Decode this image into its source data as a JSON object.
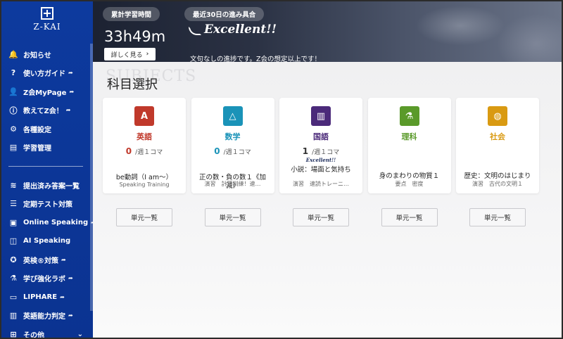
{
  "brand": {
    "logo_text": "Z-KAI"
  },
  "sidebar": {
    "items": [
      {
        "label": "お知らせ",
        "icon": "bell-icon",
        "glyph": "🔔",
        "ext": false
      },
      {
        "label": "使い方ガイド",
        "icon": "help-circle-icon",
        "glyph": "?",
        "ext": true
      },
      {
        "label": "Z会MyPage",
        "icon": "user-icon",
        "glyph": "👤",
        "ext": true
      },
      {
        "label": "教えてZ会！",
        "icon": "info-circle-icon",
        "glyph": "ⓘ",
        "ext": true
      },
      {
        "label": "各種設定",
        "icon": "gear-icon",
        "glyph": "⚙",
        "ext": false
      },
      {
        "label": "学習管理",
        "icon": "id-card-icon",
        "glyph": "▤",
        "ext": false
      }
    ],
    "items2": [
      {
        "label": "提出済み答案一覧",
        "icon": "layers-icon",
        "glyph": "≋",
        "ext": false
      },
      {
        "label": "定期テスト対策",
        "icon": "clipboard-icon",
        "glyph": "☰",
        "ext": false
      },
      {
        "label": "Online Speaking",
        "icon": "online-speaking-icon",
        "glyph": "▣",
        "ext": true
      },
      {
        "label": "AI Speaking",
        "icon": "ai-speaking-icon",
        "glyph": "◫",
        "ext": false
      },
      {
        "label": "英検®対策",
        "icon": "eiken-icon",
        "glyph": "✪",
        "ext": true
      },
      {
        "label": "学び強化ラボ",
        "icon": "flask-icon",
        "glyph": "⚗",
        "ext": true
      },
      {
        "label": "LIPHARE",
        "icon": "monitor-icon",
        "glyph": "▭",
        "ext": true
      },
      {
        "label": "英語能力判定",
        "icon": "chart-monitor-icon",
        "glyph": "▥",
        "ext": true
      },
      {
        "label": "その他",
        "icon": "grid-icon",
        "glyph": "⊞",
        "ext": false
      }
    ],
    "ext_glyph": "➦",
    "chevron": "⌄"
  },
  "header": {
    "study_time_label": "累計学習時間",
    "study_time_value": "33h49m",
    "detail_button": "詳しく見る",
    "progress_label": "最近30日の進み具合",
    "progress_badge": "Excellent!!",
    "progress_message": "文句なしの進捗です。Z会の想定以上です！"
  },
  "main": {
    "watermark": "SUBJECTS",
    "title": "科目選択",
    "unit_button": "単元一覧",
    "weekly_suffix": "/週１コマ",
    "subjects": [
      {
        "name": "英語",
        "color": "#c0392b",
        "icon": "english-icon",
        "glyph": "A",
        "count": "0",
        "count_color": "#c0392b",
        "excellent": "",
        "lesson": "be動詞（I am～）",
        "meta": "Speaking Training"
      },
      {
        "name": "数学",
        "color": "#1a93b8",
        "icon": "compass-icon",
        "glyph": "△",
        "count": "0",
        "count_color": "#1a93b8",
        "excellent": "",
        "lesson": "正の数・負の数１《加減》",
        "meta": "演習　計算訓練！速…"
      },
      {
        "name": "国語",
        "color": "#4b2a7a",
        "icon": "books-icon",
        "glyph": "▥",
        "count": "1",
        "count_color": "#333333",
        "excellent": "Excellent!!",
        "lesson": "小説：場面と気持ち",
        "meta": "演習　速読トレーニ…"
      },
      {
        "name": "理科",
        "color": "#5a9a2a",
        "icon": "microscope-icon",
        "glyph": "⚗",
        "count": "",
        "count_color": "#333333",
        "excellent": "",
        "lesson": "身のまわりの物質１",
        "meta": "要点　密度"
      },
      {
        "name": "社会",
        "color": "#d99a12",
        "icon": "globe-icon",
        "glyph": "◍",
        "count": "",
        "count_color": "#333333",
        "excellent": "",
        "lesson": "歴史：文明のはじまり",
        "meta": "演習　古代の文明１"
      }
    ]
  }
}
